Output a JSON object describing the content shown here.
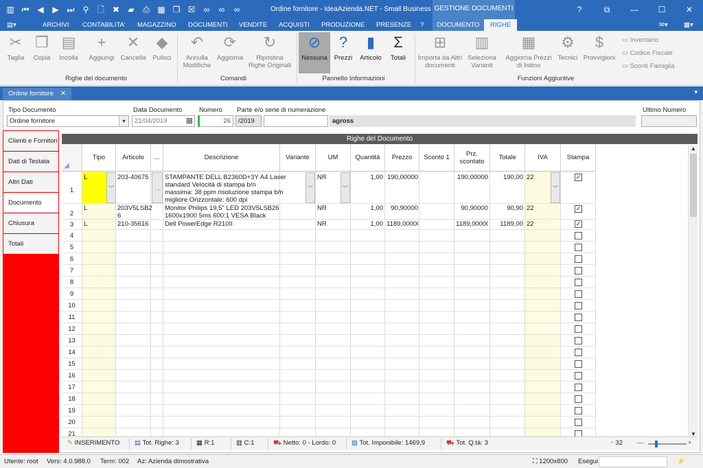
{
  "titlebar": {
    "window_title": "Ordine fornitore - IdeaAzienda.NET - Small Business ...",
    "context_tab": "GESTIONE DOCUMENTI",
    "help_label": "?"
  },
  "menu": {
    "items": [
      "ARCHIVI",
      "CONTABILITA'",
      "MAGAZZINO",
      "DOCUMENTI",
      "VENDITE",
      "ACQUISTI",
      "PRODUZIONE",
      "PRESENZE",
      "?"
    ],
    "context_items": [
      "DOCUMENTO",
      "RIGHE"
    ]
  },
  "ribbon": {
    "riga": {
      "taglia": "Taglia",
      "copia": "Copia",
      "incolla": "Incolla",
      "aggiungi": "Aggiungi",
      "cancella": "Cancella",
      "pulisci": "Pulisci",
      "group": "Righe del documento"
    },
    "comandi": {
      "annulla": "Annulla Modifiche",
      "aggiorna": "Aggiorna",
      "ripristina": "Ripristina Righe Originali",
      "group": "Comandi"
    },
    "pannello": {
      "nessuna": "Nessuna",
      "prezzi": "Prezzi",
      "articolo": "Articolo",
      "totali": "Totali",
      "group": "Pannello Informazioni"
    },
    "funzioni": {
      "importa": "Importa da Altri documenti",
      "seleziona": "Seleziona Varianti",
      "aggiorna_prezzi": "Aggiorna Prezzi di listino",
      "tecnici": "Tecnici",
      "provvigioni": "Provvigioni",
      "inventario": "Inventario",
      "codice_fiscale": "Codice Fiscale",
      "sconti": "Sconti Famiglia",
      "group": "Funzioni Aggiuntive"
    }
  },
  "doc_tab": {
    "label": "Ordine fornitore",
    "close": "✕"
  },
  "header": {
    "tipo_label": "Tipo Documento",
    "tipo_value": "Ordine fornitore",
    "data_label": "Data Documento",
    "data_value": "21/04/2019",
    "numero_label": "Numero",
    "numero_value": "26",
    "serie_label": "Parte e/o serie di numerazione",
    "serie_value": "/2019",
    "agross": "agross",
    "ultimo_label": "Ultimo Numero"
  },
  "sidenav": [
    "Clienti e Fornitori",
    "Dati di Testata",
    "Altri Dati",
    "Documento",
    "Chiusura",
    "Totali"
  ],
  "grid": {
    "title": "Righe del Documento",
    "headers": [
      "Tipo",
      "Articolo",
      "...",
      "Descrizione",
      "Variante",
      "UM",
      "Quantità",
      "Prezzo",
      "Sconto 1",
      "Prz. scontato",
      "Totale",
      "IVA",
      "Stampa"
    ],
    "rows": [
      {
        "num": "1",
        "tipo": "L",
        "articolo": "203-40675",
        "descr": [
          "STAMPANTE DELL B2360D+3Y A4 Laser",
          "standard Velocità di stampa b/n",
          "massima: 38 ppm risoluzione stampa b/n",
          "migliore Orizzontale: 600 dpi"
        ],
        "um": "NR",
        "qta": "1,00",
        "prezzo": "190,00000",
        "scontato": "190,00000",
        "totale": "190,00",
        "iva": "22",
        "stampa": true
      },
      {
        "num": "2",
        "tipo": "L",
        "articolo": [
          "203V5LSB2",
          "6"
        ],
        "descr": [
          "Monitor Philips 19,5\" LED 203V5LSB26",
          "1600x1900 5ms 600:1 VESA Black"
        ],
        "um": "NR",
        "qta": "1,00",
        "prezzo": "90,90000",
        "scontato": "90,90000",
        "totale": "90,90",
        "iva": "22",
        "stampa": true
      },
      {
        "num": "3",
        "tipo": "L",
        "articolo": "210-35616",
        "descr": [
          "Dell PowerEdge R210II"
        ],
        "um": "NR",
        "qta": "1,00",
        "prezzo": "1189,00000",
        "scontato": "1189,00000",
        "totale": "1189,00",
        "iva": "22",
        "stampa": true
      }
    ],
    "empty_rows": [
      "4",
      "5",
      "6",
      "7",
      "8",
      "9",
      "10",
      "11",
      "12",
      "13",
      "14",
      "15",
      "16",
      "17",
      "18",
      "19",
      "20",
      "21"
    ]
  },
  "status": {
    "mode": "INSERIMENTO",
    "tot_righe": "Tot. Righe: 3",
    "riga": "R:1",
    "col": "C:1",
    "netto": "Netto: 0 - Lordo: 0",
    "imponibile": "Tot. Imponibile: 1469,9",
    "qta": "Tot. Q.tà: 3",
    "counter": "32"
  },
  "footer": {
    "utente": "Utente: root",
    "vers": "Vers: 4.0.988.0",
    "term": "Term: 002",
    "az": "Az: Azienda dimostrativa",
    "res": "1200x800",
    "esegui": "Esegui"
  }
}
